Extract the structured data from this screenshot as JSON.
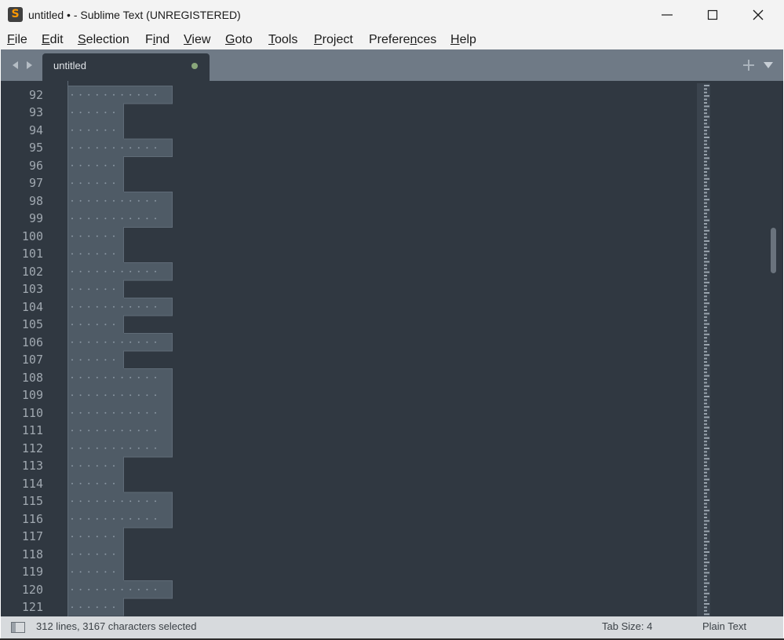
{
  "window": {
    "title": "untitled • - Sublime Text (UNREGISTERED)",
    "icon": "sublime-text-logo-icon",
    "app_icon_glyph": "S",
    "controls": [
      "minimize-icon",
      "maximize-icon",
      "close-icon"
    ]
  },
  "menu": [
    {
      "pre": "",
      "mn": "F",
      "rest": "ile"
    },
    {
      "pre": "",
      "mn": "E",
      "rest": "dit"
    },
    {
      "pre": "",
      "mn": "S",
      "rest": "election"
    },
    {
      "pre": "F",
      "mn": "i",
      "rest": "nd"
    },
    {
      "pre": "",
      "mn": "V",
      "rest": "iew"
    },
    {
      "pre": "",
      "mn": "G",
      "rest": "oto"
    },
    {
      "pre": "",
      "mn": "T",
      "rest": "ools"
    },
    {
      "pre": "",
      "mn": "P",
      "rest": "roject"
    },
    {
      "pre": "Prefere",
      "mn": "n",
      "rest": "ces"
    },
    {
      "pre": "",
      "mn": "H",
      "rest": "elp"
    }
  ],
  "tab": {
    "label": "untitled",
    "dirty": true
  },
  "tabbar": {
    "icons": [
      "nav-back-icon",
      "nav-forward-icon",
      "plus-icon",
      "triangle-down-icon"
    ]
  },
  "editor": {
    "first_line": 92,
    "lines": [
      {
        "n": "92",
        "w": "long"
      },
      {
        "n": "93",
        "w": "short"
      },
      {
        "n": "94",
        "w": "short"
      },
      {
        "n": "95",
        "w": "long"
      },
      {
        "n": "96",
        "w": "short"
      },
      {
        "n": "97",
        "w": "short"
      },
      {
        "n": "98",
        "w": "long"
      },
      {
        "n": "99",
        "w": "long"
      },
      {
        "n": "100",
        "w": "short"
      },
      {
        "n": "101",
        "w": "short"
      },
      {
        "n": "102",
        "w": "long"
      },
      {
        "n": "103",
        "w": "short"
      },
      {
        "n": "104",
        "w": "long"
      },
      {
        "n": "105",
        "w": "short"
      },
      {
        "n": "106",
        "w": "long"
      },
      {
        "n": "107",
        "w": "short"
      },
      {
        "n": "108",
        "w": "long"
      },
      {
        "n": "109",
        "w": "long"
      },
      {
        "n": "110",
        "w": "long"
      },
      {
        "n": "111",
        "w": "long"
      },
      {
        "n": "112",
        "w": "long"
      },
      {
        "n": "113",
        "w": "short"
      },
      {
        "n": "114",
        "w": "short"
      },
      {
        "n": "115",
        "w": "long"
      },
      {
        "n": "116",
        "w": "long"
      },
      {
        "n": "117",
        "w": "short"
      },
      {
        "n": "118",
        "w": "short"
      },
      {
        "n": "119",
        "w": "short"
      },
      {
        "n": "120",
        "w": "long"
      },
      {
        "n": "121",
        "w": "short"
      }
    ],
    "whitespace_dots": {
      "short": 6,
      "long": 11
    }
  },
  "colors": {
    "editor_bg": "#303841",
    "selection": "#4f5b66",
    "selection_border": "#5f6b77",
    "line_number": "#a0a8b0",
    "dirty_dot": "#89a67a",
    "tabbar_bg": "#6f7a86"
  },
  "status": {
    "text": "312 lines, 3167 characters selected",
    "tab_size": "Tab Size: 4",
    "syntax": "Plain Text",
    "sidebar_icon": "sidebar-toggle-icon"
  }
}
